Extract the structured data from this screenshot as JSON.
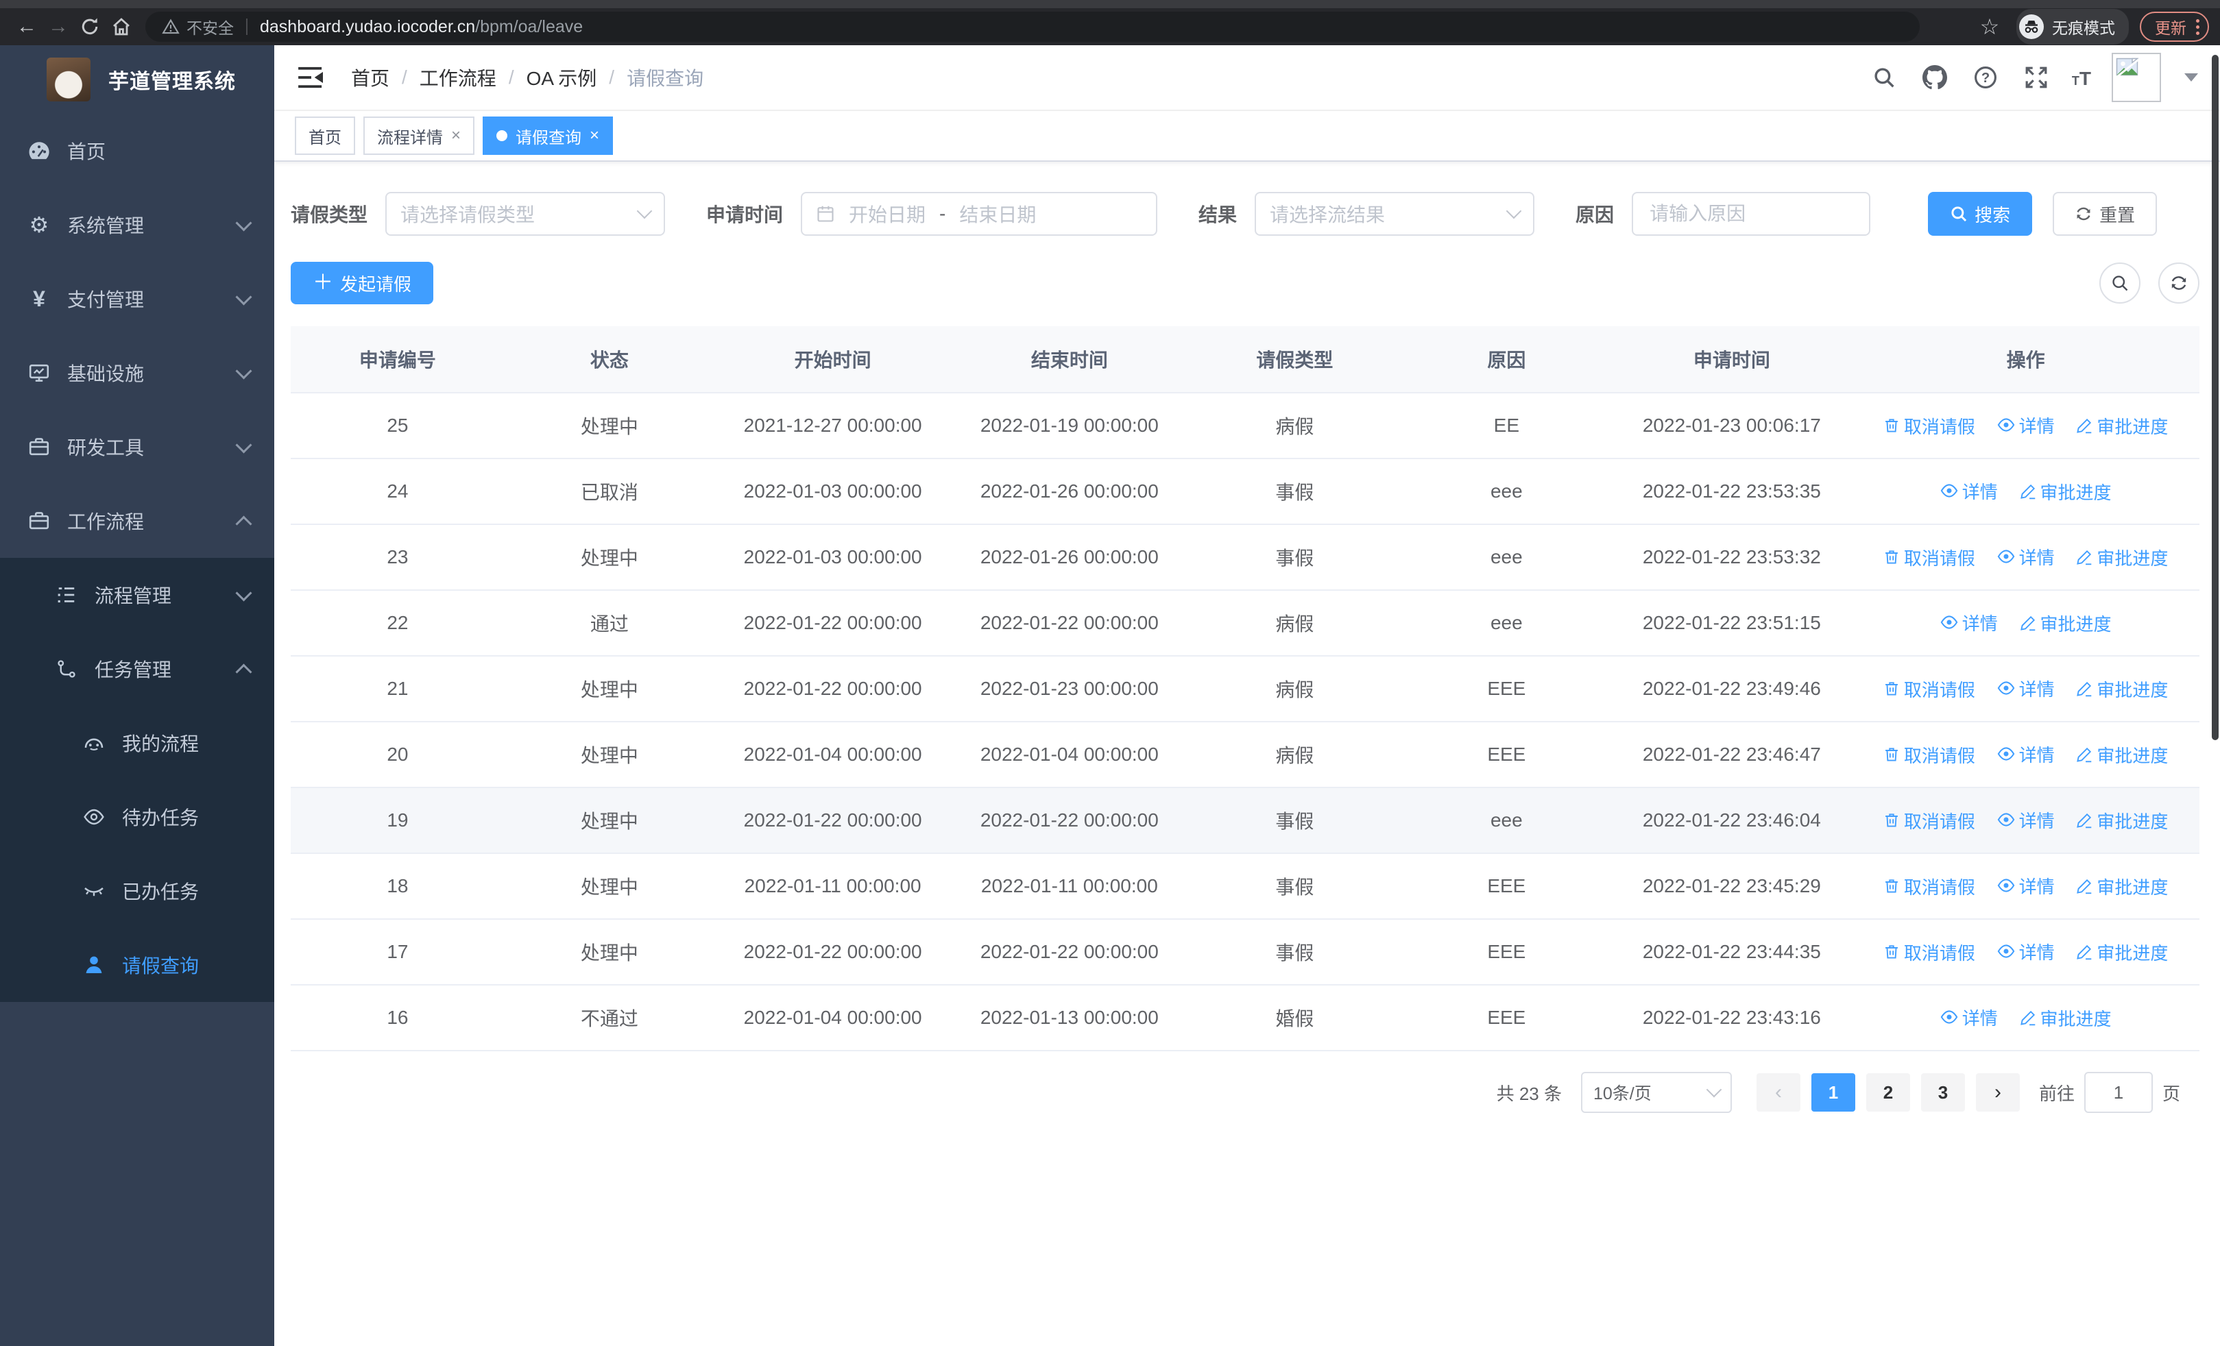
{
  "colors": {
    "primary": "#409eff",
    "sidebar_bg": "#333f53",
    "submenu_bg": "#1f2d3d",
    "update_accent": "#e9948a"
  },
  "browser": {
    "security_label": "不安全",
    "url_host": "dashboard.yudao.iocoder.cn",
    "url_path": "/bpm/oa/leave",
    "incognito_label": "无痕模式",
    "update_label": "更新"
  },
  "sidebar": {
    "title": "芋道管理系统",
    "items": [
      {
        "label": "首页",
        "icon": "dashboard-icon"
      },
      {
        "label": "系统管理",
        "icon": "gear-icon"
      },
      {
        "label": "支付管理",
        "icon": "yen-icon"
      },
      {
        "label": "基础设施",
        "icon": "monitor-icon"
      },
      {
        "label": "研发工具",
        "icon": "toolbox-icon"
      },
      {
        "label": "工作流程",
        "icon": "briefcase-icon"
      },
      {
        "label": "流程管理",
        "icon": "tree-list-icon"
      },
      {
        "label": "任务管理",
        "icon": "flow-branch-icon"
      },
      {
        "label": "我的流程",
        "icon": "robot-face-icon"
      },
      {
        "label": "待办任务",
        "icon": "eye-open-icon"
      },
      {
        "label": "已办任务",
        "icon": "eye-closed-icon"
      },
      {
        "label": "请假查询",
        "icon": "user-icon"
      }
    ]
  },
  "header": {
    "breadcrumb": [
      "首页",
      "工作流程",
      "OA 示例",
      "请假查询"
    ]
  },
  "tabs": [
    {
      "label": "首页"
    },
    {
      "label": "流程详情"
    },
    {
      "label": "请假查询"
    }
  ],
  "filters": {
    "type_label": "请假类型",
    "type_placeholder": "请选择请假类型",
    "time_label": "申请时间",
    "start_placeholder": "开始日期",
    "range_separator": "-",
    "end_placeholder": "结束日期",
    "result_label": "结果",
    "result_placeholder": "请选择流结果",
    "reason_label": "原因",
    "reason_placeholder": "请输入原因",
    "search_label": "搜索",
    "reset_label": "重置"
  },
  "toolbar": {
    "create_label": "发起请假"
  },
  "table": {
    "headers": [
      "申请编号",
      "状态",
      "开始时间",
      "结束时间",
      "请假类型",
      "原因",
      "申请时间",
      "操作"
    ],
    "action_labels": {
      "cancel": "取消请假",
      "detail": "详情",
      "progress": "审批进度"
    },
    "rows": [
      {
        "id": "25",
        "status": "处理中",
        "start": "2021-12-27 00:00:00",
        "end": "2022-01-19 00:00:00",
        "type": "病假",
        "reason": "EE",
        "applied": "2022-01-23 00:06:17",
        "can_cancel": true
      },
      {
        "id": "24",
        "status": "已取消",
        "start": "2022-01-03 00:00:00",
        "end": "2022-01-26 00:00:00",
        "type": "事假",
        "reason": "eee",
        "applied": "2022-01-22 23:53:35",
        "can_cancel": false
      },
      {
        "id": "23",
        "status": "处理中",
        "start": "2022-01-03 00:00:00",
        "end": "2022-01-26 00:00:00",
        "type": "事假",
        "reason": "eee",
        "applied": "2022-01-22 23:53:32",
        "can_cancel": true
      },
      {
        "id": "22",
        "status": "通过",
        "start": "2022-01-22 00:00:00",
        "end": "2022-01-22 00:00:00",
        "type": "病假",
        "reason": "eee",
        "applied": "2022-01-22 23:51:15",
        "can_cancel": false
      },
      {
        "id": "21",
        "status": "处理中",
        "start": "2022-01-22 00:00:00",
        "end": "2022-01-23 00:00:00",
        "type": "病假",
        "reason": "EEE",
        "applied": "2022-01-22 23:49:46",
        "can_cancel": true
      },
      {
        "id": "20",
        "status": "处理中",
        "start": "2022-01-04 00:00:00",
        "end": "2022-01-04 00:00:00",
        "type": "病假",
        "reason": "EEE",
        "applied": "2022-01-22 23:46:47",
        "can_cancel": true
      },
      {
        "id": "19",
        "status": "处理中",
        "start": "2022-01-22 00:00:00",
        "end": "2022-01-22 00:00:00",
        "type": "事假",
        "reason": "eee",
        "applied": "2022-01-22 23:46:04",
        "can_cancel": true,
        "highlighted": true
      },
      {
        "id": "18",
        "status": "处理中",
        "start": "2022-01-11 00:00:00",
        "end": "2022-01-11 00:00:00",
        "type": "事假",
        "reason": "EEE",
        "applied": "2022-01-22 23:45:29",
        "can_cancel": true
      },
      {
        "id": "17",
        "status": "处理中",
        "start": "2022-01-22 00:00:00",
        "end": "2022-01-22 00:00:00",
        "type": "事假",
        "reason": "EEE",
        "applied": "2022-01-22 23:44:35",
        "can_cancel": true
      },
      {
        "id": "16",
        "status": "不通过",
        "start": "2022-01-04 00:00:00",
        "end": "2022-01-13 00:00:00",
        "type": "婚假",
        "reason": "EEE",
        "applied": "2022-01-22 23:43:16",
        "can_cancel": false
      }
    ]
  },
  "pagination": {
    "total_text": "共 23 条",
    "page_size": "10条/页",
    "prev": "‹",
    "next": "›",
    "pages": [
      "1",
      "2",
      "3"
    ],
    "current": "1",
    "goto_label": "前往",
    "goto_value": "1",
    "goto_suffix": "页"
  }
}
